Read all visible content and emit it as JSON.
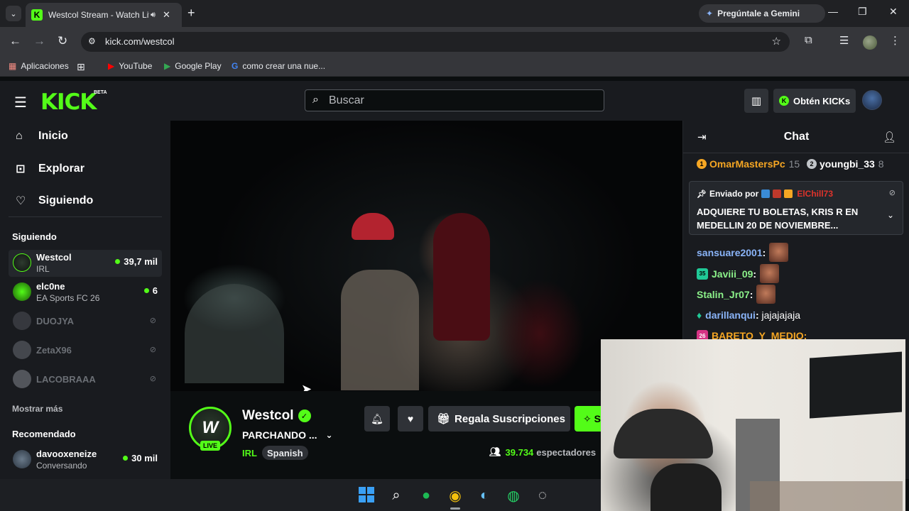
{
  "browser": {
    "tab_title": "Westcol Stream - Watch Live",
    "url": "kick.com/westcol",
    "gemini_label": "Pregúntale a Gemini",
    "bookmarks": [
      {
        "label": "Aplicaciones",
        "icon": "apps-grid-icon"
      },
      {
        "label": "YouTube",
        "icon": "youtube-icon"
      },
      {
        "label": "Google Play",
        "icon": "google-play-icon"
      },
      {
        "label": "como crear una nue...",
        "icon": "google-icon"
      }
    ]
  },
  "header": {
    "logo": "KICK",
    "logo_beta": "BETA",
    "search_placeholder": "Buscar",
    "kicks_label": "Obtén KICKs"
  },
  "sidebar": {
    "nav": [
      {
        "label": "Inicio",
        "icon": "home-icon"
      },
      {
        "label": "Explorar",
        "icon": "compass-icon"
      },
      {
        "label": "Siguiendo",
        "icon": "heart-icon"
      }
    ],
    "following_heading": "Siguiendo",
    "following": [
      {
        "name": "Westcol",
        "category": "IRL",
        "viewers": "39,7 mil",
        "live": true
      },
      {
        "name": "elc0ne",
        "category": "EA Sports FC 26",
        "viewers": "6",
        "live": true
      },
      {
        "name": "DUOJYA",
        "live": false
      },
      {
        "name": "ZetaX96",
        "live": false
      },
      {
        "name": "LACOBRAAA",
        "live": false
      }
    ],
    "show_more": "Mostrar más",
    "recommended_heading": "Recomendado",
    "recommended": [
      {
        "name": "davooxeneize",
        "category": "Conversando",
        "viewers": "30 mil"
      }
    ]
  },
  "channel": {
    "name": "Westcol",
    "avatar_text": "W",
    "live_badge": "LIVE",
    "title": "PARCHANDO ...",
    "category": "IRL",
    "tag": "Spanish",
    "gift_label": "Regala Suscripciones",
    "subscribe_label": "Suscribirse",
    "viewers_count": "39.734",
    "viewers_label": "espectadores"
  },
  "chat": {
    "title": "Chat",
    "top_gifters": [
      {
        "rank": "1",
        "name": "OmarMastersPc",
        "count": "15"
      },
      {
        "rank": "2",
        "name": "youngbi_33",
        "count": "8"
      }
    ],
    "pinned": {
      "prefix": "Enviado por",
      "user": "ElChill73",
      "text": "ADQUIERE TU BOLETAS, KRIS R EN MEDELLIN 20 DE NOVIEMBRE..."
    },
    "messages": [
      {
        "user": "sansuare2001",
        "color": "#8ab4f8",
        "emote": true
      },
      {
        "user": "Javiii_09",
        "color": "#8cf28a",
        "badge": "35",
        "emote": true
      },
      {
        "user": "Stalin_Jr07",
        "color": "#8cf28a",
        "emote": true
      },
      {
        "user": "darillanqui",
        "color": "#8ab4f8",
        "text": "jajajajaja"
      },
      {
        "user": "BARETO_Y_MEDIO",
        "color": "#f5a623",
        "badge": "26"
      }
    ]
  },
  "colors": {
    "kick_green": "#53fc18",
    "bg": "#0b0e0f",
    "panel": "#191b1f"
  }
}
